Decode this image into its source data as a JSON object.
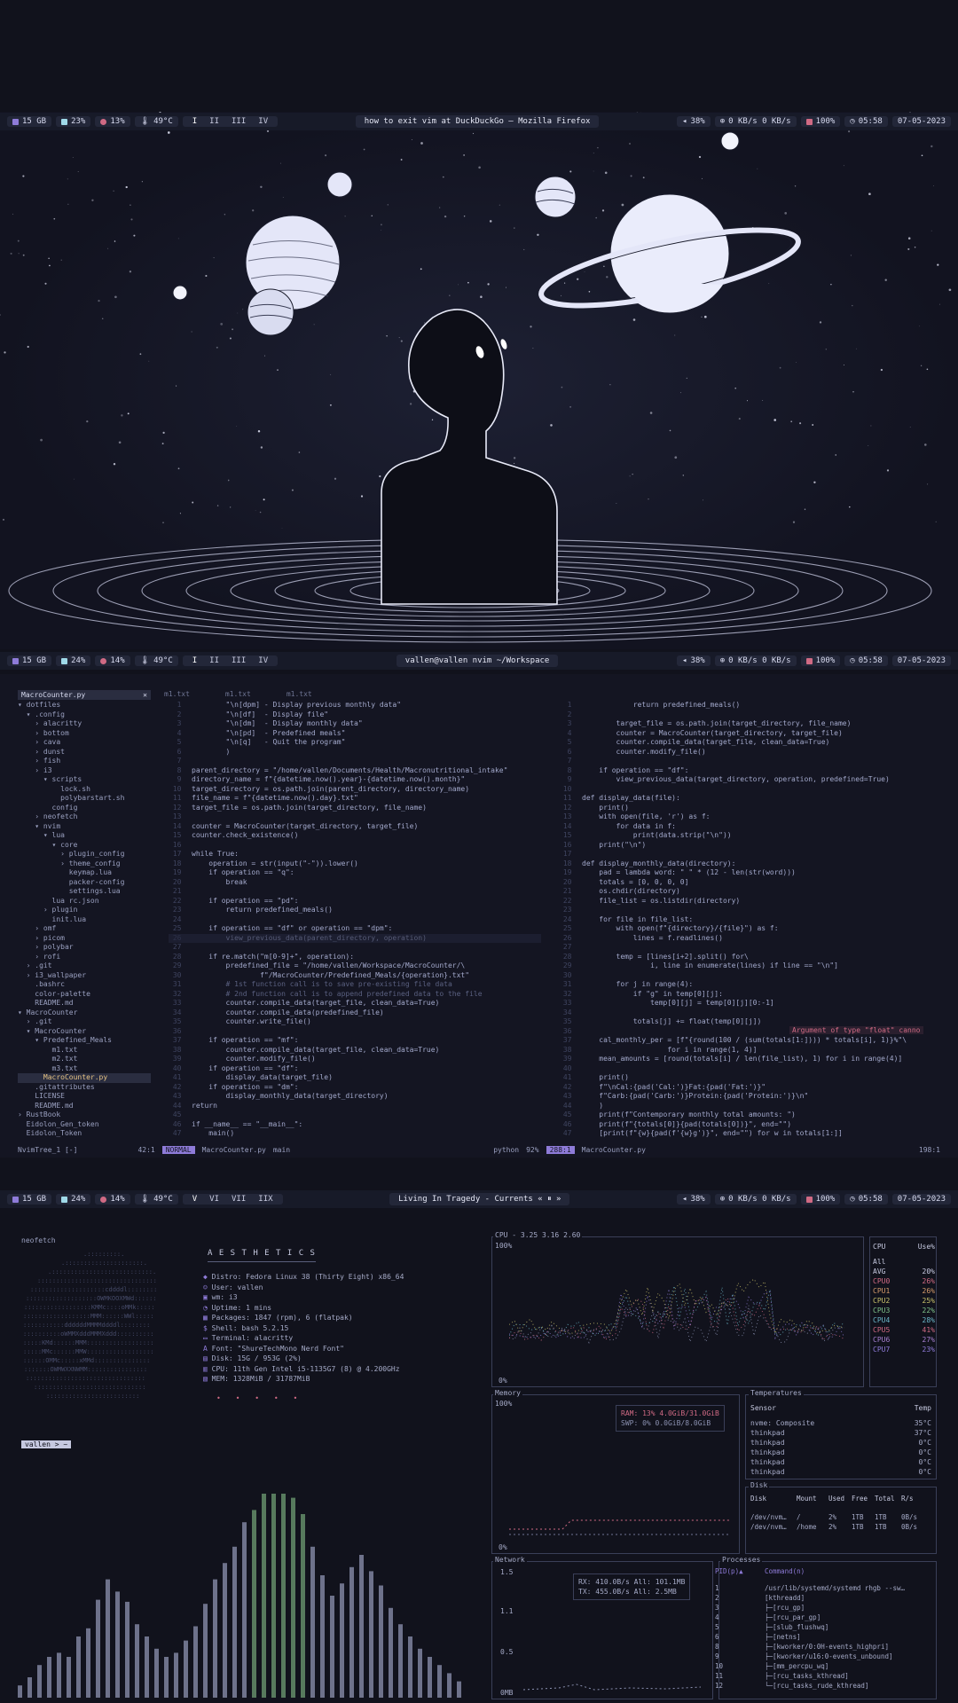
{
  "screen1": {
    "bar": {
      "disk": "15 GB",
      "mem": "23%",
      "cpu": "13%",
      "temp": "49°C",
      "workspaces": [
        "I",
        "II",
        "III",
        "IV"
      ],
      "title": "how to exit vim at DuckDuckGo — Mozilla Firefox",
      "volume": "38%",
      "net": "0 KB/s  0 KB/s",
      "battery": "100%",
      "time": "05:58",
      "date": "07-05-2023"
    }
  },
  "screen2": {
    "bar": {
      "disk": "15 GB",
      "mem": "24%",
      "cpu": "14%",
      "temp": "49°C",
      "workspaces": [
        "I",
        "II",
        "III",
        "IV"
      ],
      "title": "vallen@vallen nvim ~/Workspace",
      "volume": "38%",
      "net": "0 KB/s  0 KB/s",
      "battery": "100%",
      "time": "05:58",
      "date": "07-05-2023"
    },
    "tree_header": "MacroCounter.py",
    "tree": [
      "▾ dotfiles",
      "  ▾ .config",
      "    › alacritty",
      "    › bottom",
      "    › cava",
      "    › dunst",
      "    › fish",
      "    › i3",
      "      ▾ scripts",
      "          lock.sh",
      "          polybarstart.sh",
      "        config",
      "    › neofetch",
      "    ▾ nvim",
      "      ▾ lua",
      "        ▾ core",
      "          › plugin_config",
      "          › theme_config",
      "            keymap.lua",
      "            packer-config",
      "            settings.lua",
      "        lua rc.json",
      "      › plugin",
      "        init.lua",
      "    › omf",
      "    › picom",
      "    › polybar",
      "    › rofi",
      "  › .git",
      "  › i3_wallpaper",
      "    .bashrc",
      "    color-palette",
      "    README.md",
      "▾ MacroCounter",
      "  › .git",
      "  ▾ MacroCounter",
      "    ▾ Predefined_Meals",
      "        m1.txt",
      "        m2.txt",
      "        m3.txt",
      "      MacroCounter.py",
      "    .gitattributes",
      "    LICENSE",
      "    README.md",
      "› RustBook",
      "  Eidolon_Gen_token",
      "  Eidolon_Token"
    ],
    "tabs": [
      "m1.txt",
      "m1.txt",
      "m1.txt"
    ],
    "code_left": [
      "        \"\\n[dpm] - Display previous monthly data\"",
      "        \"\\n[df]  - Display file\"",
      "        \"\\n[dm]  - Display monthly data\"",
      "        \"\\n[pd]  - Predefined meals\"",
      "        \"\\n[q]   - Quit the program\"",
      "        )",
      "",
      "parent_directory = \"/home/vallen/Documents/Health/Macronutritional_intake\"",
      "directory_name = f\"{datetime.now().year}-{datetime.now().month}\"",
      "target_directory = os.path.join(parent_directory, directory_name)",
      "file_name = f\"{datetime.now().day}.txt\"",
      "target_file = os.path.join(target_directory, file_name)",
      "",
      "counter = MacroCounter(target_directory, target_file)",
      "counter.check_existence()",
      "",
      "while True:",
      "    operation = str(input(\"-\")).lower()",
      "    if operation == \"q\":",
      "        break",
      "",
      "    if operation == \"pd\":",
      "        return predefined_meals()",
      "",
      "    if operation == \"df\" or operation == \"dpm\":",
      "        view_previous_data(parent_directory, operation)",
      "",
      "    if re.match(\"m[0-9]+\", operation):",
      "        predefined_file = \"/home/vallen/Workspace/MacroCounter/\\",
      "                f\"/MacroCounter/Predefined_Meals/{operation}.txt\"",
      "        # 1st function call is to save pre-existing file data",
      "        # 2nd function call is to append predefined data to the file",
      "        counter.compile_data(target_file, clean_data=True)",
      "        counter.compile_data(predefined_file)",
      "        counter.write_file()",
      "",
      "    if operation == \"mf\":",
      "        counter.compile_data(target_file, clean_data=True)",
      "        counter.modify_file()",
      "    if operation == \"df\":",
      "        display_data(target_file)",
      "    if operation == \"dm\":",
      "        display_monthly_data(target_directory)",
      "return",
      "",
      "if __name__ == \"__main__\":",
      "    main()"
    ],
    "code_right": [
      "            return predefined_meals()",
      "",
      "        target_file = os.path.join(target_directory, file_name)",
      "        counter = MacroCounter(target_directory, target_file)",
      "        counter.compile_data(target_file, clean_data=True)",
      "        counter.modify_file()",
      "",
      "    if operation == \"df\":",
      "        view_previous_data(target_directory, operation, predefined=True)",
      "",
      "def display_data(file):",
      "    print()",
      "    with open(file, 'r') as f:",
      "        for data in f:",
      "            print(data.strip(\"\\n\"))",
      "    print(\"\\n\")",
      "",
      "def display_monthly_data(directory):",
      "    pad = lambda word: \" \" * (12 - len(str(word)))",
      "    totals = [0, 0, 0, 0]",
      "    os.chdir(directory)",
      "    file_list = os.listdir(directory)",
      "",
      "    for file in file_list:",
      "        with open(f\"{directory}/{file}\") as f:",
      "            lines = f.readlines()",
      "",
      "        temp = [lines[i+2].split() for\\",
      "                i, line in enumerate(lines) if line == \"\\n\"]",
      "",
      "        for j in range(4):",
      "            if \"g\" in temp[0][j]:",
      "                temp[0][j] = temp[0][j][0:-1]",
      "",
      "            totals[j] += float(temp[0][j])",
      "",
      "    cal_monthly_per = [f\"{round(100 / (sum(totals[1:]))) * totals[i], 1)}%\"\\",
      "                    for i in range(1, 4)]",
      "    mean_amounts = [round(totals[i] / len(file_list), 1) for i in range(4)]",
      "",
      "    print()",
      "    f\"\\nCal:{pad('Cal:')}Fat:{pad('Fat:')}\"",
      "    f\"Carb:{pad('Carb:')}Protein:{pad('Protein:')}\\n\"",
      "    )",
      "    print(f\"Contemporary monthly total amounts: \")",
      "    print(f\"{totals[0]}{pad(totals[0])}\", end=\"\")",
      "    [print(f\"{w}{pad(f'{w}g')}\", end=\"\") for w in totals[1:]]"
    ],
    "diag_error": "Argument of type \"float\" canno",
    "status_left": {
      "mode": "NORMAL",
      "file": "MacroCounter.py",
      "branch": "main",
      "pos": "42:1",
      "tree": "NvimTree_1 [-]"
    },
    "status_right": {
      "lang": "python",
      "pct": "92%",
      "pos": "288:1",
      "file": "MacroCounter.py",
      "pos2": "198:1"
    }
  },
  "screen3": {
    "bar": {
      "disk": "15 GB",
      "mem": "24%",
      "cpu": "14%",
      "temp": "49°C",
      "workspaces": [
        "V",
        "VI",
        "VII",
        "IIX"
      ],
      "title": "Living In Tragedy - Currents",
      "volume": "38%",
      "net": "0 KB/s  0 KB/s",
      "battery": "100%",
      "time": "05:58",
      "date": "07-05-2023"
    },
    "neofetch_cmd": "neofetch",
    "aesthetics": "A E S T H E T I C S",
    "info": [
      "Distro: Fedora Linux 38 (Thirty Eight) x86_64",
      "User: vallen",
      "wm: i3",
      "Uptime: 1 mins",
      "Packages: 1847 (rpm), 6 (flatpak)",
      "Shell: bash 5.2.15",
      "Terminal: alacritty",
      "Font: \"ShureTechMono Nerd Font\"",
      "Disk: 15G / 953G (2%)",
      "CPU: 11th Gen Intel i5-1135G7 (8) @ 4.200GHz",
      "MEM: 1328MiB / 31787MiB"
    ],
    "prompt": "vallen > ~",
    "cpu_box": {
      "title": "CPU - 3.25 3.16 2.60",
      "top": "100%",
      "bottom": "0%"
    },
    "cpu_list": {
      "head": [
        "CPU",
        "Use%"
      ],
      "rows": [
        [
          "All",
          ""
        ],
        [
          "AVG",
          "20%"
        ],
        [
          "CPU0",
          "26%"
        ],
        [
          "CPU1",
          "26%"
        ],
        [
          "CPU2",
          "25%"
        ],
        [
          "CPU3",
          "22%"
        ],
        [
          "CPU4",
          "28%"
        ],
        [
          "CPU5",
          "41%"
        ],
        [
          "CPU6",
          "27%"
        ],
        [
          "CPU7",
          "23%"
        ]
      ]
    },
    "mem_box": {
      "title": "Memory",
      "top": "100%",
      "bottom": "0%",
      "ram": "RAM: 13%    4.0GiB/31.0GiB",
      "swp": "SWP:  0%    0.0GiB/8.0GiB"
    },
    "temps": {
      "title": "Temperatures",
      "head": [
        "Sensor",
        "Temp"
      ],
      "rows": [
        [
          "nvme: Composite",
          "35°C"
        ],
        [
          "thinkpad",
          "37°C"
        ],
        [
          "thinkpad",
          "0°C"
        ],
        [
          "thinkpad",
          "0°C"
        ],
        [
          "thinkpad",
          "0°C"
        ],
        [
          "thinkpad",
          "0°C"
        ]
      ]
    },
    "disk": {
      "title": "Disk",
      "head": [
        "Disk",
        "Mount",
        "Used",
        "Free",
        "Total",
        "R/s"
      ],
      "rows": [
        [
          "/dev/nvm…",
          "/",
          "2%",
          "1TB",
          "1TB",
          "0B/s"
        ],
        [
          "/dev/nvm…",
          "/home",
          "2%",
          "1TB",
          "1TB",
          "0B/s"
        ]
      ]
    },
    "network": {
      "title": "Network",
      "y": [
        "1.5",
        "1.1",
        "0.5",
        "0MB"
      ],
      "rx": "RX: 410.0B/s   All: 101.1MB",
      "tx": "TX: 455.0B/s   All:  2.5MB"
    },
    "processes": {
      "title": "Processes",
      "head": [
        "PID(p)▲",
        "Command(n)"
      ],
      "rows": [
        [
          "1",
          "/usr/lib/systemd/systemd rhgb --sw…"
        ],
        [
          "2",
          "[kthreadd]"
        ],
        [
          "3",
          "├─[rcu_gp]"
        ],
        [
          "4",
          "├─[rcu_par_gp]"
        ],
        [
          "5",
          "├─[slub_flushwq]"
        ],
        [
          "6",
          "├─[netns]"
        ],
        [
          "8",
          "├─[kworker/0:0H-events_highpri]"
        ],
        [
          "9",
          "├─[kworker/u16:0-events_unbound]"
        ],
        [
          "10",
          "├─[mm_percpu_wq]"
        ],
        [
          "11",
          "├─[rcu_tasks_kthread]"
        ],
        [
          "12",
          "└─[rcu_tasks_rude_kthread]"
        ]
      ]
    },
    "cava_levels": [
      0.06,
      0.1,
      0.16,
      0.2,
      0.22,
      0.2,
      0.3,
      0.34,
      0.48,
      0.58,
      0.52,
      0.47,
      0.36,
      0.3,
      0.24,
      0.2,
      0.22,
      0.28,
      0.35,
      0.46,
      0.58,
      0.66,
      0.74,
      0.86,
      0.92,
      1,
      1,
      1,
      0.98,
      0.9,
      0.74,
      0.6,
      0.5,
      0.56,
      0.64,
      0.7,
      0.62,
      0.55,
      0.44,
      0.36,
      0.3,
      0.24,
      0.2,
      0.16,
      0.12,
      0.08
    ]
  },
  "colors": {
    "bg": "#11121c",
    "bar": "#171a28",
    "accent": "#8e7bd8",
    "bar_green": "#6f9e73",
    "bar_gray": "#8d93b0",
    "planet": "#e4e6f8",
    "error": "#d06a84"
  }
}
